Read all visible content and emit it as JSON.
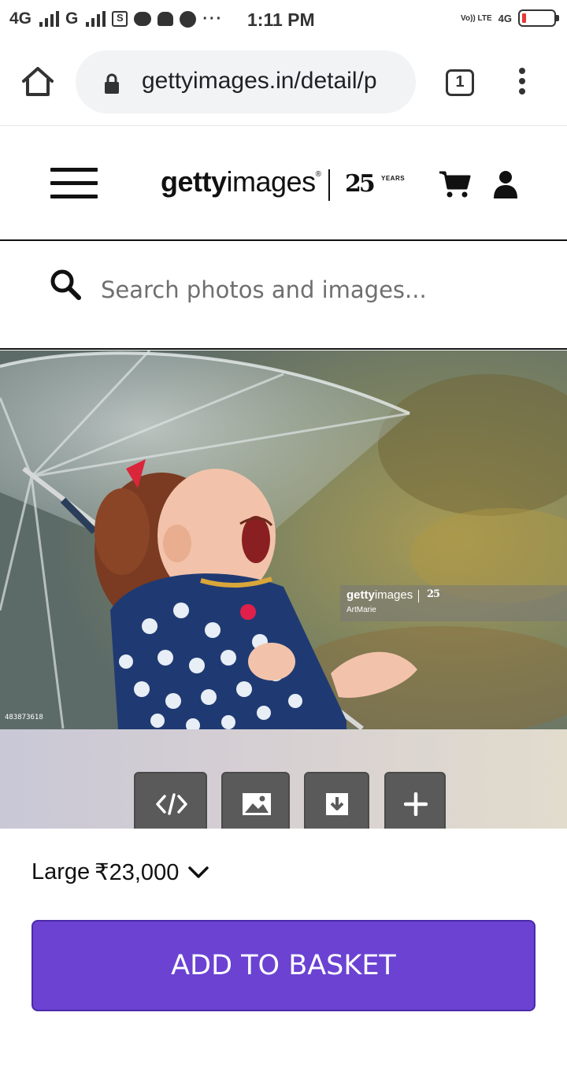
{
  "status_bar": {
    "network_1": "4G",
    "network_2": "G",
    "sim_icon_glyph": "S",
    "more": "···",
    "time": "1:11 PM",
    "volte": "Vo)) LTE",
    "network_3": "4G",
    "battery_color": "#e53935"
  },
  "browser": {
    "url": "gettyimages.in/detail/p",
    "tab_count": "1"
  },
  "site": {
    "logo_bold": "getty",
    "logo_light": "images",
    "logo_reg": "®",
    "years_num": "25",
    "years_label": "YEARS"
  },
  "search": {
    "placeholder": "Search photos and images..."
  },
  "image": {
    "watermark_logo_bold": "getty",
    "watermark_logo_light": "images",
    "watermark_years": "25",
    "credit": "ArtMarie",
    "image_id": "483873618"
  },
  "tools": {
    "embed_icon": "embed-code-icon",
    "comp_icon": "image-icon",
    "download_icon": "download-icon",
    "add_icon": "plus-icon"
  },
  "purchase": {
    "size_label": "Large",
    "price": "₹23,000",
    "add_to_basket": "ADD TO BASKET",
    "button_color": "#6b42d2"
  }
}
